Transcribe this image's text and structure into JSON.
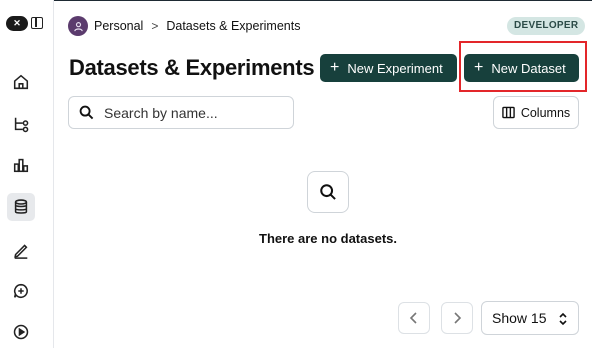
{
  "breadcrumb": {
    "workspace": "Personal",
    "separator": ">",
    "current": "Datasets & Experiments"
  },
  "badge": "DEVELOPER",
  "page_title": "Datasets & Experiments",
  "actions": {
    "new_experiment": "New Experiment",
    "new_dataset": "New Dataset",
    "plus": "+"
  },
  "search": {
    "placeholder": "Search by name...",
    "value": ""
  },
  "columns_label": "Columns",
  "empty_state": {
    "message": "There are no datasets."
  },
  "pagination": {
    "show_label": "Show 15"
  },
  "colors": {
    "primary_button": "#17403c",
    "badge_bg": "#d4e6e3",
    "highlight": "#e3262a",
    "avatar": "#5b3b6d"
  },
  "sidebar_icons": [
    "home-icon",
    "workflow-icon",
    "analytics-icon",
    "database-icon",
    "pencil-icon",
    "feedback-icon",
    "play-icon"
  ]
}
